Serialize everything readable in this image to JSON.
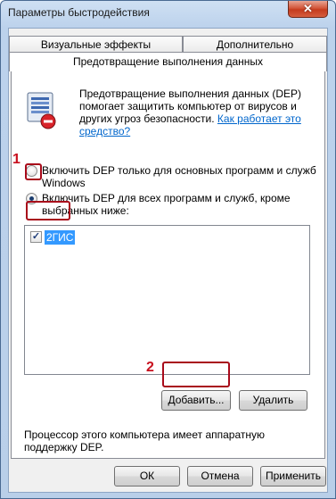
{
  "window": {
    "title": "Параметры быстродействия",
    "close_glyph": "✕"
  },
  "tabs": {
    "visual_effects": "Визуальные эффекты",
    "advanced": "Дополнительно",
    "dep": "Предотвращение выполнения данных"
  },
  "dep_info": {
    "text": "Предотвращение выполнения данных (DEP) помогает защитить компьютер от вирусов и других угроз безопасности. ",
    "link": "Как работает это средство?",
    "icon": "dep-shield-icon"
  },
  "options": {
    "essential_only": "Включить DEP только для основных программ и служб Windows",
    "all_except": "Включить DEP для всех программ и служб, кроме выбранных ниже:",
    "selected": "all_except"
  },
  "exceptions_list": [
    {
      "label": "2ГИС",
      "checked": true,
      "check_glyph": "✓"
    }
  ],
  "buttons": {
    "add": "Добавить...",
    "remove": "Удалить",
    "ok": "ОК",
    "cancel": "Отмена",
    "apply": "Применить"
  },
  "hardware_note": "Процессор этого компьютера имеет аппаратную поддержку DEP.",
  "annotations": {
    "step1": "1",
    "step2": "2",
    "color": "#c8101e"
  },
  "colors": {
    "selection": "#3399ff",
    "link": "#0066cc",
    "close_button": "#c53b1d"
  }
}
